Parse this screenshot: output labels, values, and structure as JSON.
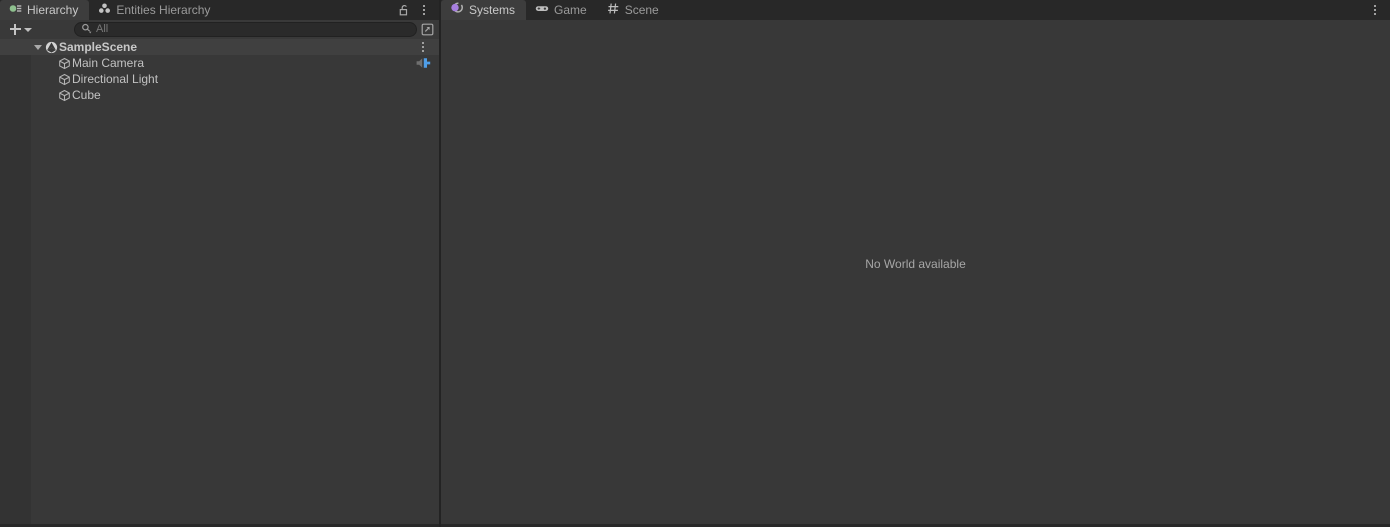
{
  "window": {
    "background_color": "#383838",
    "tabbar_color": "#282828",
    "active_tab_color": "#3d3d3d"
  },
  "left_panel": {
    "tabs": [
      {
        "label": "Hierarchy",
        "icon": "hierarchy-icon",
        "active": true,
        "accent": "#8ec08e"
      },
      {
        "label": "Entities Hierarchy",
        "icon": "entities-cluster-icon",
        "active": false
      }
    ],
    "tab_actions": [
      {
        "name": "lock-icon",
        "label": "Lock"
      },
      {
        "name": "kebab-menu-icon",
        "label": "More"
      }
    ],
    "toolbar": {
      "add_label": "+",
      "add_dropdown": "caret-down-icon",
      "search": {
        "placeholder": "All",
        "value": "",
        "icon": "search-icon"
      },
      "picker_icon": "object-picker-icon"
    },
    "tree": [
      {
        "label": "SampleScene",
        "icon": "unity-scene-icon",
        "depth": 0,
        "expanded": true,
        "bold": true,
        "selected": true,
        "right_icon": "kebab-menu-icon"
      },
      {
        "label": "Main Camera",
        "icon": "gameobject-cube-icon",
        "depth": 1,
        "right_icon": "audio-listener-icon",
        "right_icon_color": "#4f9ee8"
      },
      {
        "label": "Directional Light",
        "icon": "gameobject-cube-icon",
        "depth": 1
      },
      {
        "label": "Cube",
        "icon": "gameobject-cube-icon",
        "depth": 1
      }
    ]
  },
  "right_panel": {
    "tabs": [
      {
        "label": "Systems",
        "icon": "systems-icon",
        "active": true,
        "accent": "#a77fe0"
      },
      {
        "label": "Game",
        "icon": "gamepad-icon",
        "active": false
      },
      {
        "label": "Scene",
        "icon": "scene-grid-icon",
        "active": false
      }
    ],
    "tab_actions": [
      {
        "name": "kebab-menu-icon",
        "label": "More"
      }
    ],
    "content": {
      "empty_message": "No World available"
    }
  }
}
